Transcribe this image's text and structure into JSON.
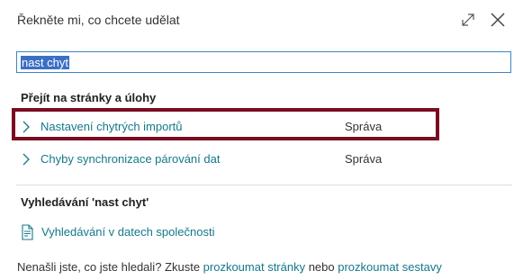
{
  "dialog": {
    "title": "Řekněte mi, co chcete udělat",
    "expand_icon": "expand-icon",
    "close_icon": "close-icon"
  },
  "search": {
    "value": "nast chyt"
  },
  "pages_section": {
    "heading": "Přejít na stránky a úlohy",
    "results": [
      {
        "label": "Nastavení chytrých importů",
        "category": "Správa"
      },
      {
        "label": "Chyby synchronizace párování dat",
        "category": "Správa"
      }
    ]
  },
  "search_section": {
    "heading": "Vyhledávání 'nast chyt'",
    "company_search_label": "Vyhledávání v datech společnosti"
  },
  "footer": {
    "prefix": "Nenašli jste, co jste hledali? Zkuste ",
    "link1": "prozkoumat stránky",
    "middle": " nebo ",
    "link2": "prozkoumat sestavy"
  },
  "colors": {
    "link": "#14788b",
    "highlight_border": "#7a0c22",
    "selection": "#3b6fc4",
    "input_border": "#3a86c8"
  }
}
